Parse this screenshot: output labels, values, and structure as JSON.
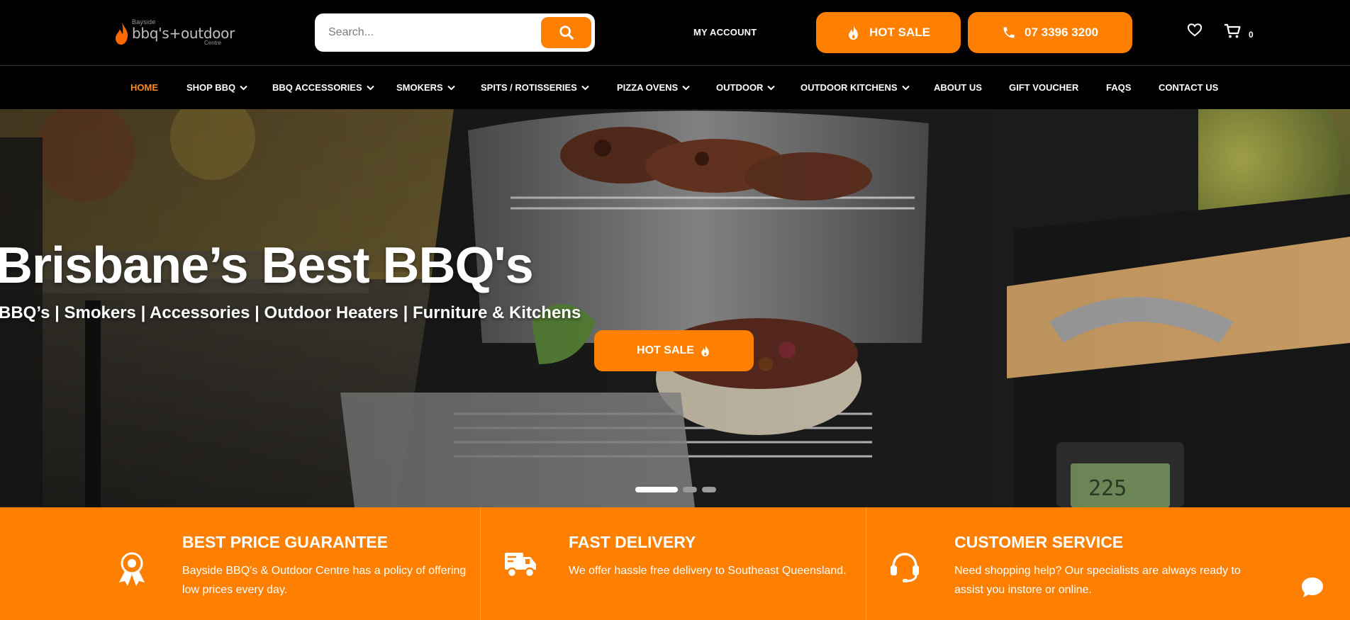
{
  "header": {
    "logo": {
      "small_text": "Bayside",
      "main_text": "bbq's+outdoor",
      "centre_text": "Centre"
    },
    "search": {
      "placeholder": "Search..."
    },
    "my_account": "MY ACCOUNT",
    "hot_sale": "HOT SALE",
    "phone": "07 3396 3200",
    "cart_count": "0"
  },
  "nav": {
    "items": [
      {
        "label": "HOME"
      },
      {
        "label": "SHOP BBQ"
      },
      {
        "label": "BBQ ACCESSORIES"
      },
      {
        "label": "SMOKERS"
      },
      {
        "label": "SPITS / ROTISSERIES"
      },
      {
        "label": "PIZZA OVENS"
      },
      {
        "label": "OUTDOOR"
      },
      {
        "label": "OUTDOOR KITCHENS"
      },
      {
        "label": "ABOUT US"
      },
      {
        "label": "GIFT VOUCHER"
      },
      {
        "label": "FAQS"
      },
      {
        "label": "CONTACT US"
      }
    ]
  },
  "hero": {
    "title": "Brisbane’s Best BBQ's",
    "subtitle": "BBQ’s | Smokers | Accessories | Outdoor Heaters | Furniture & Kitchens",
    "cta": "HOT SALE",
    "slide_count": 3,
    "active_slide": 1
  },
  "features": [
    {
      "title": "BEST PRICE GUARANTEE",
      "text": "Bayside BBQ's & Outdoor Centre has a policy of offering low prices every day.",
      "icon": "award-ribbon-icon"
    },
    {
      "title": "FAST DELIVERY",
      "text": "We offer hassle free delivery to Southeast Queensland.",
      "icon": "delivery-truck-icon"
    },
    {
      "title": "CUSTOMER SERVICE",
      "text": "Need shopping help? Our specialists are always ready to assist you instore or online.",
      "icon": "headset-icon"
    }
  ],
  "colors": {
    "accent": "#ff7f00",
    "header_bg": "#000000",
    "active_nav": "#ff8a1f"
  }
}
